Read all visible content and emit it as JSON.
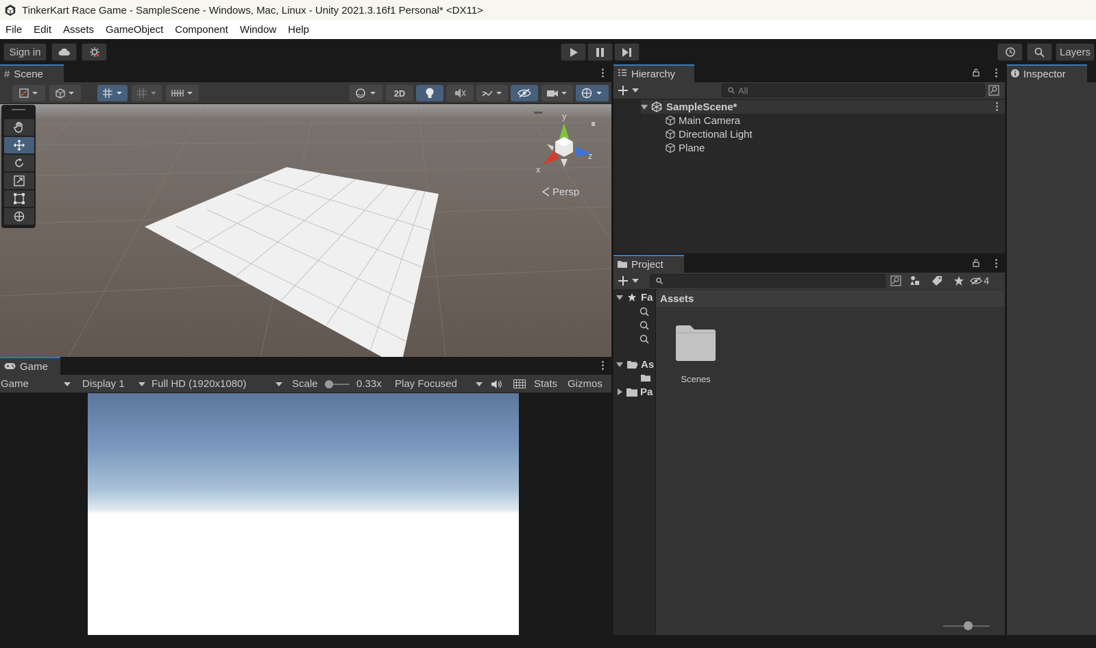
{
  "window": {
    "title": "TinkerKart Race Game - SampleScene - Windows, Mac, Linux - Unity 2021.3.16f1 Personal* <DX11>"
  },
  "menu": [
    "File",
    "Edit",
    "Assets",
    "GameObject",
    "Component",
    "Window",
    "Help"
  ],
  "toolbar": {
    "sign_in": "Sign in",
    "layers": "Layers"
  },
  "scene": {
    "tab": "Scene",
    "toggle_2d": "2D",
    "gizmo": {
      "y": "y",
      "x": "x",
      "z": "z",
      "projection": "Persp"
    }
  },
  "game": {
    "tab": "Game",
    "view_mode": "Game",
    "display": "Display 1",
    "resolution": "Full HD (1920x1080)",
    "scale_label": "Scale",
    "scale_value": "0.33x",
    "play_mode": "Play Focused",
    "stats": "Stats",
    "gizmos": "Gizmos"
  },
  "hierarchy": {
    "tab": "Hierarchy",
    "search_placeholder": "All",
    "scene_name": "SampleScene*",
    "items": [
      "Main Camera",
      "Directional Light",
      "Plane"
    ]
  },
  "inspector": {
    "tab": "Inspector"
  },
  "project": {
    "tab": "Project",
    "hidden_count": "4",
    "tree": {
      "favorites": "Fa",
      "assets": "As",
      "packages": "Pa"
    },
    "breadcrumb": "Assets",
    "folders": [
      "Scenes"
    ]
  },
  "colors": {
    "accent": "#3a79bb",
    "active_tool": "#46607c",
    "panel_bg": "#282828"
  }
}
